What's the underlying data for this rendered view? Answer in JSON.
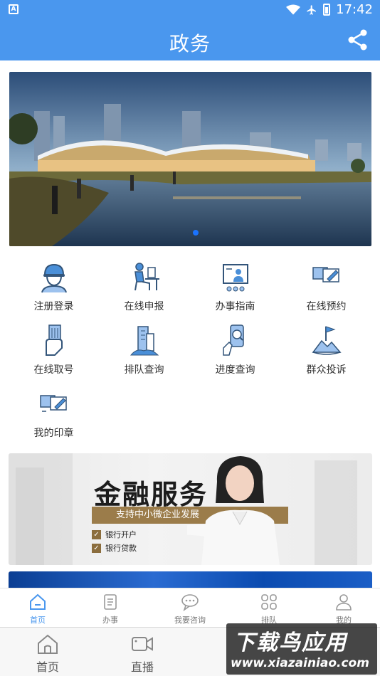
{
  "status": {
    "time": "17:42",
    "badge": "A"
  },
  "appbar": {
    "title": "政务"
  },
  "colors": {
    "brand": "#4a97ee",
    "active_dot": "#1a73ff",
    "finance_gold": "#9b7c4a"
  },
  "banner": {
    "pages": 1,
    "current": 1
  },
  "grid": [
    {
      "label": "注册登录",
      "icon": "worker-helmet-icon"
    },
    {
      "label": "在线申报",
      "icon": "person-desk-icon"
    },
    {
      "label": "办事指南",
      "icon": "presentation-icon"
    },
    {
      "label": "在线预约",
      "icon": "calendar-pen-icon"
    },
    {
      "label": "在线取号",
      "icon": "ticket-hand-icon"
    },
    {
      "label": "排队查询",
      "icon": "buildings-icon"
    },
    {
      "label": "进度查询",
      "icon": "phone-search-icon"
    },
    {
      "label": "群众投诉",
      "icon": "flag-mountain-icon"
    },
    {
      "label": "我的印章",
      "icon": "stamp-doc-icon"
    }
  ],
  "finance": {
    "title": "金融服务",
    "subtitle": "支持中小微企业发展",
    "items": [
      "银行开户",
      "银行贷款"
    ]
  },
  "nav_top": [
    {
      "label": "首页",
      "icon": "home-icon",
      "active": true
    },
    {
      "label": "办事",
      "icon": "clipboard-icon",
      "active": false
    },
    {
      "label": "我要咨询",
      "icon": "chat-bubbles-icon",
      "active": false
    },
    {
      "label": "排队",
      "icon": "squares-icon",
      "active": false
    },
    {
      "label": "我的",
      "icon": "user-icon",
      "active": false
    }
  ],
  "nav_system": [
    {
      "label": "首页",
      "icon": "home-outline-icon"
    },
    {
      "label": "直播",
      "icon": "video-camera-icon"
    }
  ],
  "watermark": {
    "brand": "下载鸟应用",
    "url": "www.xiazainiao.com"
  }
}
